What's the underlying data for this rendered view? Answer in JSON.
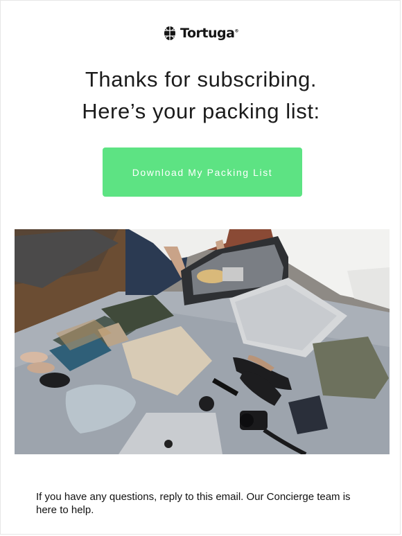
{
  "brand": {
    "name": "Tortuga",
    "trademark": "®",
    "icon": "turtle-shell-icon"
  },
  "heading": {
    "line1": "Thanks for subscribing.",
    "line2": "Here’s your packing list:"
  },
  "cta": {
    "label": "Download My Packing List",
    "color": "#5de383"
  },
  "hero_image": {
    "icon": "packing-photo"
  },
  "footer_copy": {
    "text": "If you have any questions, reply to this email. Our Concierge team is here to help."
  }
}
